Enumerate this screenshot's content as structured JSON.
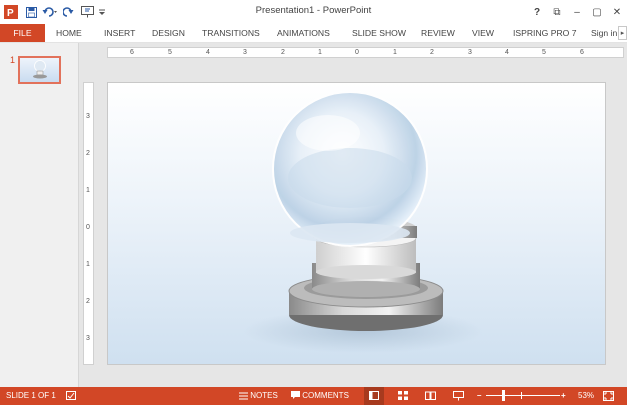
{
  "window": {
    "title": "Presentation1 - PowerPoint",
    "controls": [
      "?",
      "⧉",
      "–",
      "▢",
      "✕"
    ]
  },
  "ribbon": {
    "tabs": [
      "FILE",
      "HOME",
      "INSERT",
      "DESIGN",
      "TRANSITIONS",
      "ANIMATIONS",
      "SLIDE SHOW",
      "REVIEW",
      "VIEW",
      "ISPRING PRO 7",
      "Sign in"
    ],
    "active_tab": "FILE",
    "scroll_glyph": "▸"
  },
  "thumbnails": {
    "items": [
      {
        "number": "1"
      }
    ]
  },
  "rulers": {
    "horizontal": [
      "6",
      "5",
      "4",
      "3",
      "2",
      "1",
      "0",
      "1",
      "2",
      "3",
      "4",
      "5",
      "6"
    ],
    "vertical": [
      "3",
      "2",
      "1",
      "0",
      "1",
      "2",
      "3"
    ]
  },
  "status": {
    "slide_indicator": "SLIDE 1 OF 1",
    "notes_label": "NOTES",
    "comments_label": "COMMENTS",
    "zoom_minus": "–",
    "zoom_plus": "+",
    "zoom_level": "53%"
  },
  "colors": {
    "accent": "#d24726",
    "ribbon_text": "#444444",
    "ruler_bg": "#ffffff",
    "workspace_bg": "#e6e6e6"
  }
}
